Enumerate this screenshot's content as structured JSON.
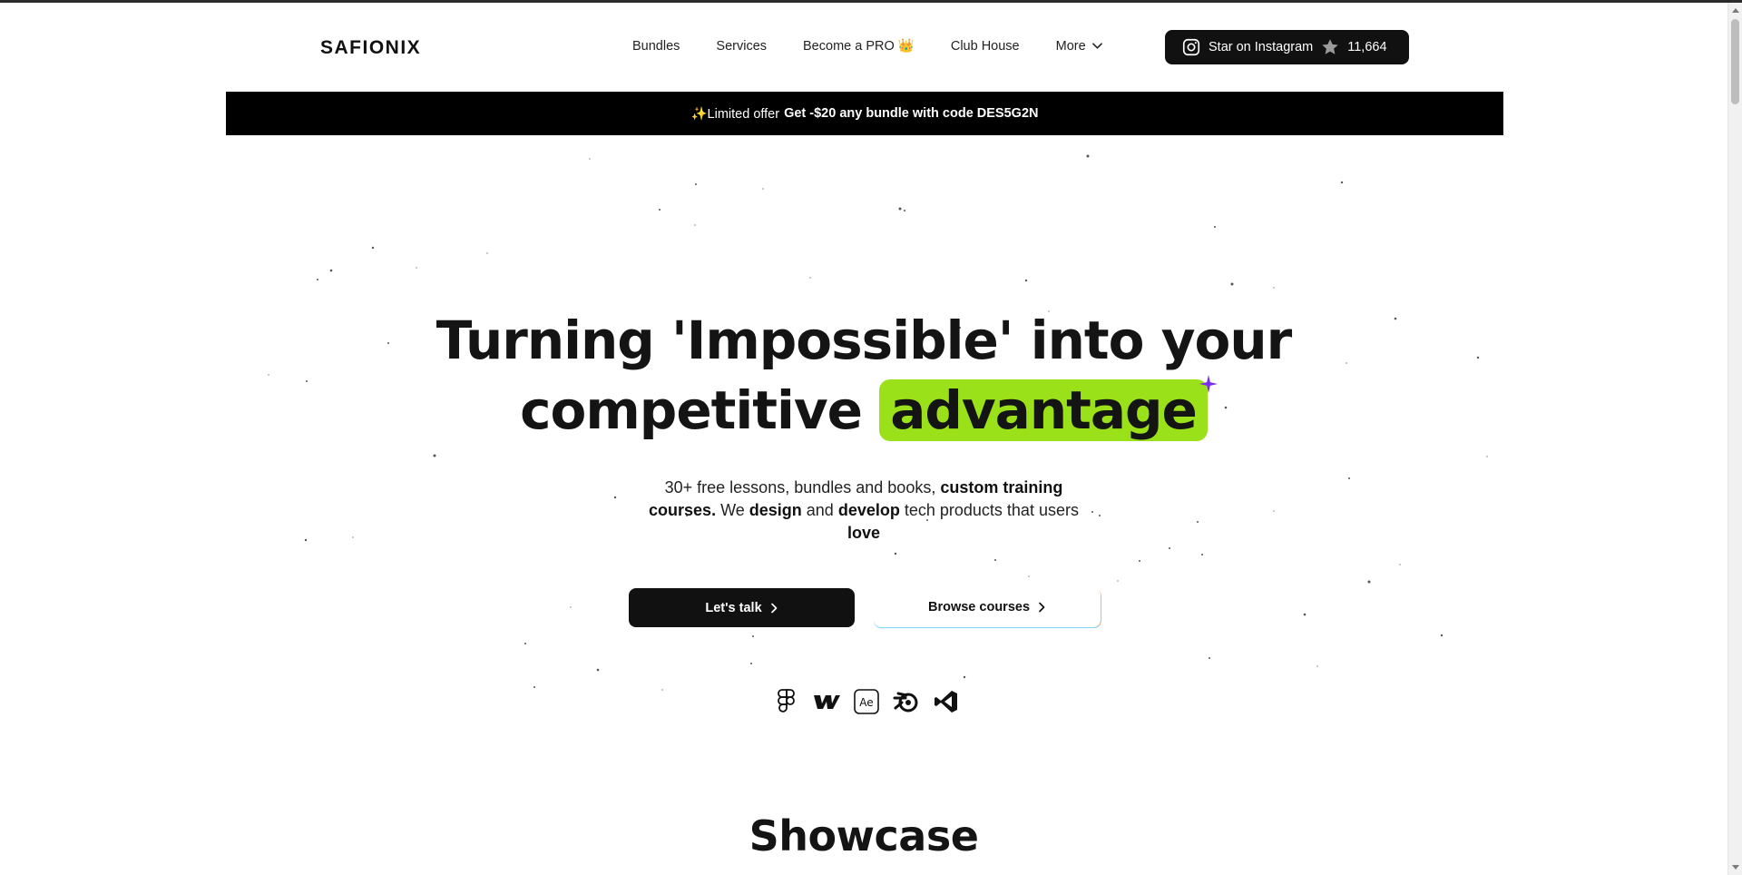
{
  "header": {
    "logo": "SAFIONIX",
    "nav": [
      {
        "label": "Bundles"
      },
      {
        "label": "Services"
      },
      {
        "label": "Become a PRO 👑"
      },
      {
        "label": "Club House"
      },
      {
        "label": "More"
      }
    ],
    "instagram_button": {
      "label": "Star on Instagram",
      "count": "11,664"
    }
  },
  "banner": {
    "prefix": "✨Limited offer",
    "offer": "Get -$20 any bundle with code DES5G2N"
  },
  "hero": {
    "title_line1": "Turning 'Impossible' into your",
    "title_line2_start": "competitive",
    "title_highlight": "advantage",
    "highlight_color": "#9be11a",
    "subtitle": {
      "part1": "30+ free lessons, bundles and books, ",
      "bold1": "custom training courses.",
      "part2": " We ",
      "bold2": "design",
      "part3": " and ",
      "bold3": "develop",
      "part4": " tech products that users ",
      "bold4": "love"
    },
    "primary_button": "Let's talk",
    "secondary_button": "Browse courses",
    "tools": [
      "figma-icon",
      "webflow-icon",
      "after-effects-icon",
      "blender-icon",
      "vscode-icon"
    ]
  },
  "showcase_title": "Showcase"
}
